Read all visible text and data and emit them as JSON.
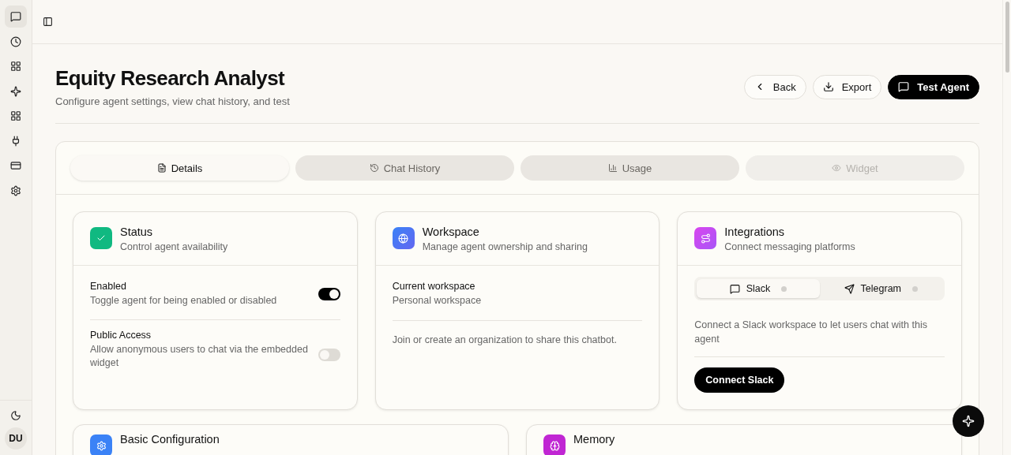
{
  "sidebar": {
    "items": [
      {
        "selected": true
      },
      {
        "selected": false
      },
      {
        "selected": false
      },
      {
        "selected": false
      },
      {
        "selected": false
      },
      {
        "selected": false
      },
      {
        "selected": false
      },
      {
        "selected": false
      }
    ],
    "avatar": "DU"
  },
  "header": {
    "title": "Equity Research Analyst",
    "subtitle": "Configure agent settings, view chat history, and test",
    "buttons": [
      {
        "label": "Back",
        "kind": "outline"
      },
      {
        "label": "Export",
        "kind": "outline"
      },
      {
        "label": "Test Agent",
        "kind": "primary"
      }
    ]
  },
  "tabs": [
    {
      "label": "Details",
      "selected": true,
      "disabled": false
    },
    {
      "label": "Chat History",
      "selected": false,
      "disabled": false
    },
    {
      "label": "Usage",
      "selected": false,
      "disabled": false
    },
    {
      "label": "Widget",
      "selected": false,
      "disabled": true
    }
  ],
  "status_card": {
    "title": "Status",
    "subtitle": "Control agent availability",
    "settings": [
      {
        "label": "Enabled",
        "description": "Toggle agent for being enabled or disabled",
        "on": true
      },
      {
        "label": "Public Access",
        "description": "Allow anonymous users to chat via the embedded widget",
        "on": false
      }
    ]
  },
  "workspace_card": {
    "title": "Workspace",
    "subtitle": "Manage agent ownership and sharing",
    "label": "Current workspace",
    "value": "Personal workspace",
    "note": "Join or create an organization to share this chatbot."
  },
  "integrations_card": {
    "title": "Integrations",
    "subtitle": "Connect messaging platforms",
    "platforms": [
      {
        "label": "Slack",
        "selected": true
      },
      {
        "label": "Telegram",
        "selected": false
      }
    ],
    "description": "Connect a Slack workspace to let users chat with this agent",
    "button": "Connect Slack"
  },
  "lower_cards": [
    {
      "title": "Basic Configuration",
      "color": "#3b82f6"
    },
    {
      "title": "Memory",
      "color": "#c026d3"
    }
  ]
}
